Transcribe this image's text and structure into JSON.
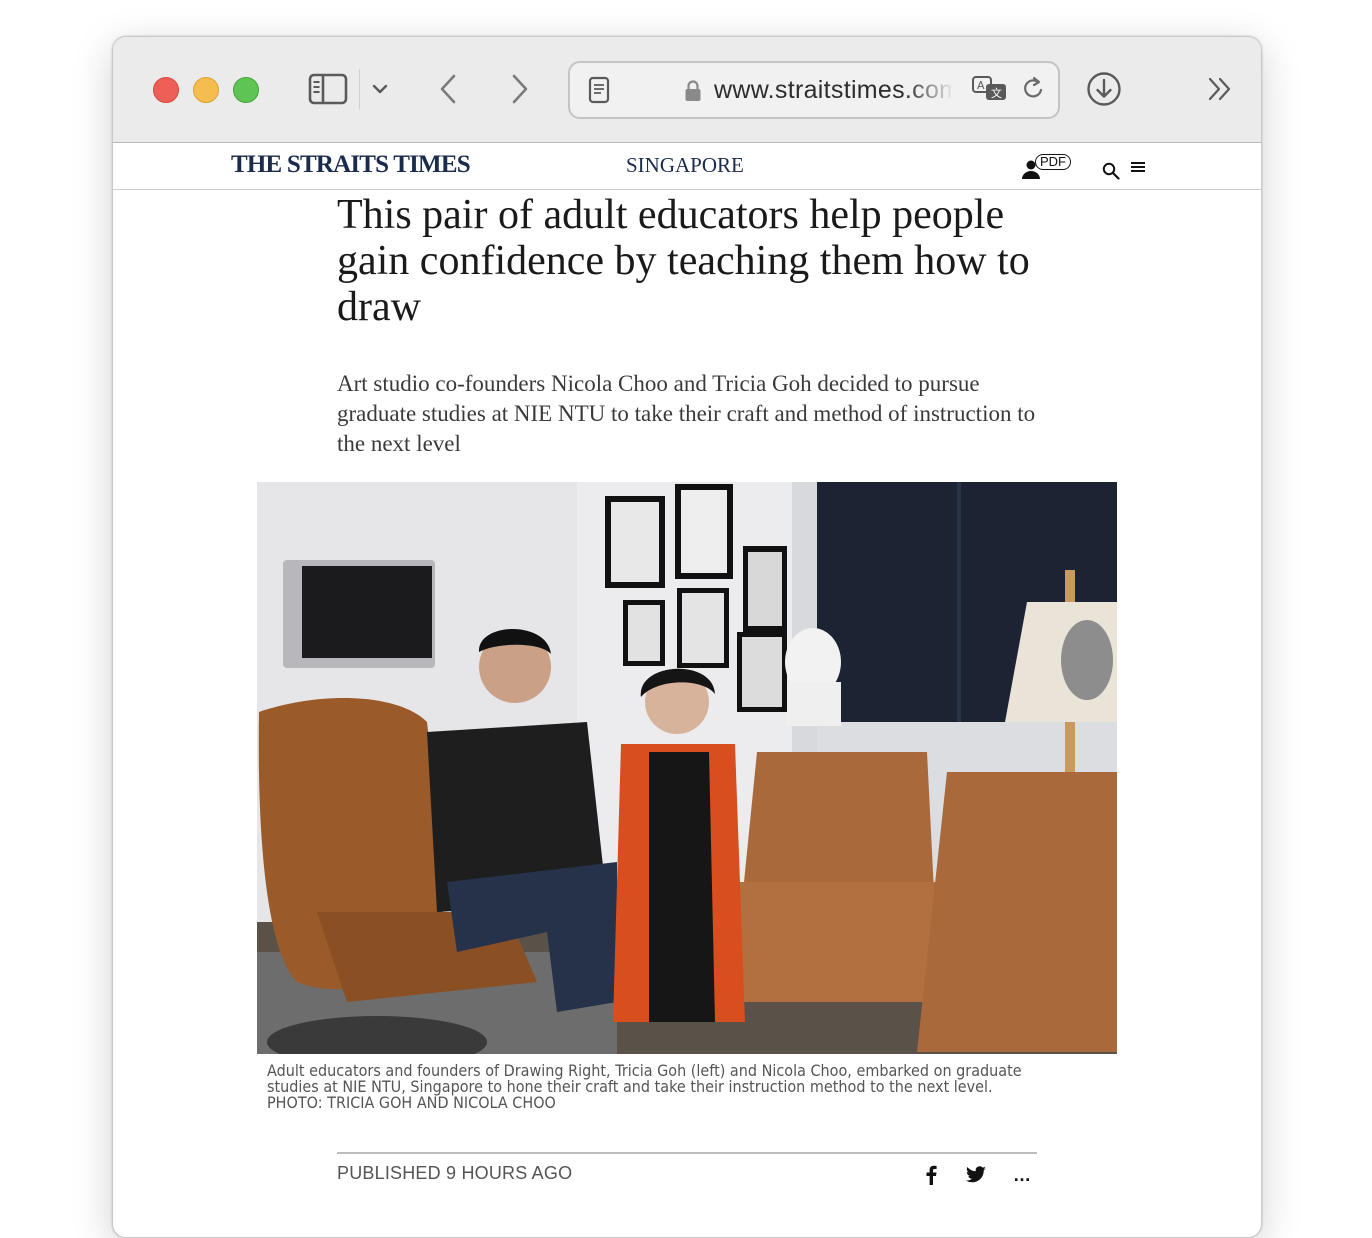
{
  "browser": {
    "address": "www.straitstimes.com",
    "sidebar_icon": "sidebar-icon",
    "back_icon": "chevron-left-icon",
    "forward_icon": "chevron-right-icon",
    "reader_icon": "reader-icon",
    "lock_icon": "lock-icon",
    "translate_icon": "translate-icon",
    "reload_icon": "reload-icon",
    "download_icon": "download-icon",
    "overflow_icon": "double-chevron-right-icon"
  },
  "site": {
    "masthead": "THE STRAITS TIMES",
    "section": "SINGAPORE",
    "pdf_label": "PDF"
  },
  "article": {
    "headline": "This pair of adult educators help people gain confidence by teaching them how to draw",
    "standfirst": "Art studio co-founders Nicola Choo and Tricia Goh decided to pursue graduate studies at NIE NTU to take their craft and method of instruction to the next level",
    "caption": "Adult educators and founders of Drawing Right, Tricia Goh (left) and Nicola Choo, embarked on graduate studies at NIE NTU, Singapore to hone their craft and take their instruction method to the next level.",
    "photo_credit": "PHOTO: TRICIA GOH AND NICOLA CHOO",
    "published": "PUBLISHED 9 HOURS AGO",
    "share_more": "…"
  },
  "colors": {
    "masthead": "#1a2b4c",
    "toolbar_bg": "#ebebeb"
  }
}
